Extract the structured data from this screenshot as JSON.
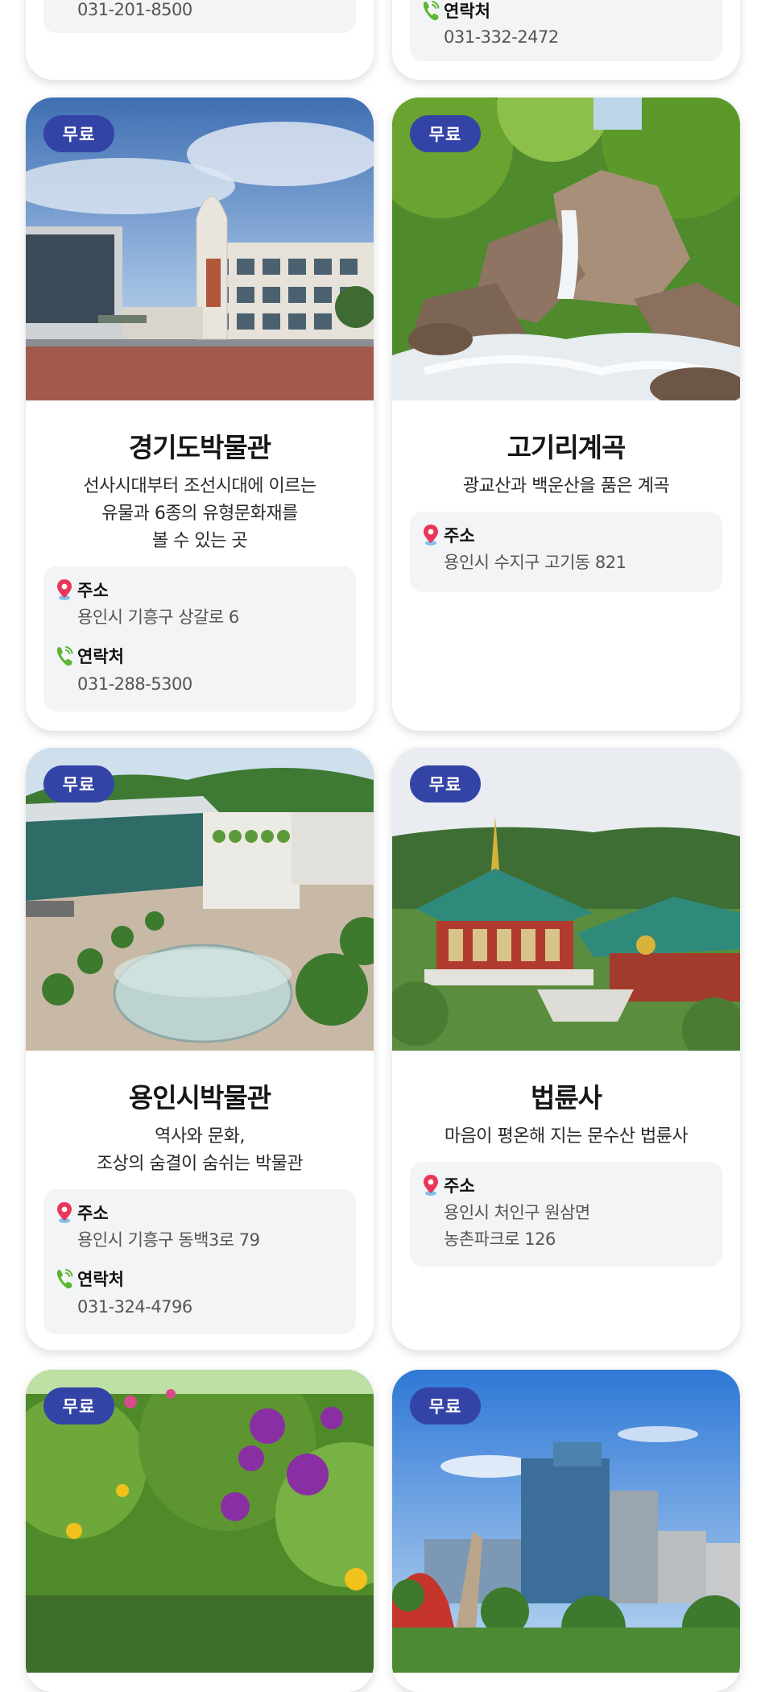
{
  "top_cards": [
    {
      "contact_value": "031-201-8500"
    },
    {
      "contact_label": "연락처",
      "contact_value": "031-332-2472"
    }
  ],
  "cards": [
    {
      "badge": "무료",
      "title": "경기도박물관",
      "desc": [
        "선사시대부터 조선시대에 이르는",
        "유물과 6종의 유형문화재를",
        "볼 수 있는 곳"
      ],
      "address_label": "주소",
      "address": [
        "용인시 기흥구 상갈로 6"
      ],
      "contact_label": "연락처",
      "contact": "031-288-5300"
    },
    {
      "badge": "무료",
      "title": "고기리계곡",
      "desc": [
        "광교산과 백운산을 품은 계곡"
      ],
      "address_label": "주소",
      "address": [
        "용인시 수지구 고기동 821"
      ]
    },
    {
      "badge": "무료",
      "title": "용인시박물관",
      "desc": [
        "역사와 문화,",
        "조상의 숨결이 숨쉬는 박물관"
      ],
      "address_label": "주소",
      "address": [
        "용인시 기흥구 동백3로 79"
      ],
      "contact_label": "연락처",
      "contact": "031-324-4796"
    },
    {
      "badge": "무료",
      "title": "법륜사",
      "desc": [
        "마음이 평온해 지는 문수산 법륜사"
      ],
      "address_label": "주소",
      "address": [
        "용인시 처인구 원삼면",
        "농촌파크로 126"
      ]
    },
    {
      "badge": "무료"
    },
    {
      "badge": "무료"
    }
  ],
  "icons": {
    "address": "map-pin-icon",
    "contact": "phone-icon"
  },
  "colors": {
    "badge": "#3443a6",
    "pin": "#e8375a",
    "phone": "#5cb531"
  }
}
